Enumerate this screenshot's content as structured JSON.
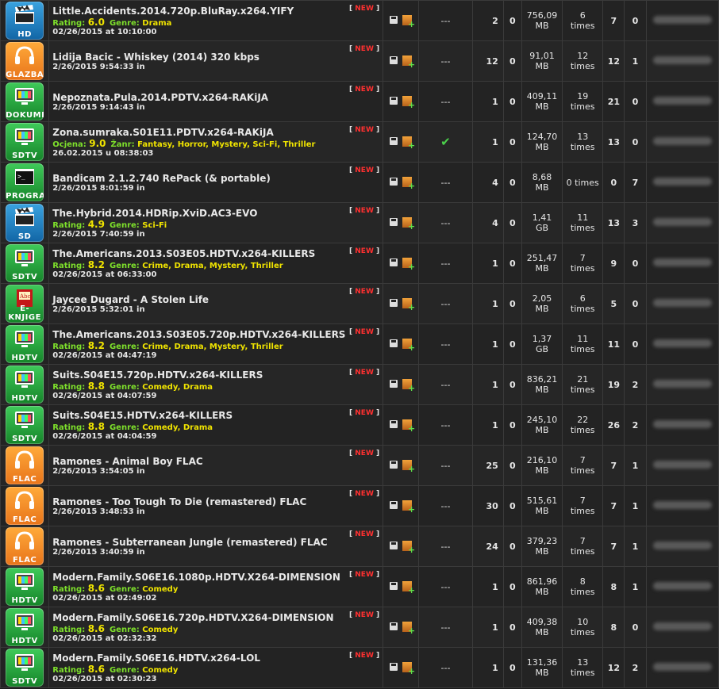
{
  "rows": [
    {
      "cat": "HD",
      "icon": "clapper",
      "cls": "ic-hd",
      "name": "Little.Accidents.2014.720p.BluRay.x264.YIFY",
      "rating_label": "Rating:",
      "rating": "6.0",
      "genre_label": "Genre:",
      "genre": "Drama",
      "date": "02/26/2015 at 10:10:00",
      "new": "NEW",
      "checked": false,
      "files": "2",
      "comments": "0",
      "size1": "756,09",
      "size2": "MB",
      "snatch1": "6",
      "snatch2": "times",
      "seed": "7",
      "leech": "0"
    },
    {
      "cat": "GLAZBA",
      "icon": "headphones",
      "cls": "ic-music",
      "name": "Lidija Bacic - Whiskey (2014) 320 kbps",
      "rating_label": "",
      "rating": "",
      "genre_label": "",
      "genre": "",
      "date": "2/26/2015 9:54:33 in",
      "new": "NEW",
      "checked": false,
      "files": "12",
      "comments": "0",
      "size1": "91,01",
      "size2": "MB",
      "snatch1": "12",
      "snatch2": "times",
      "seed": "12",
      "leech": "1"
    },
    {
      "cat": "DOKUME",
      "icon": "tv",
      "cls": "ic-doc",
      "name": "Nepoznata.Pula.2014.PDTV.x264-RAKiJA",
      "rating_label": "",
      "rating": "",
      "genre_label": "",
      "genre": "",
      "date": "2/26/2015 9:14:43 in",
      "new": "NEW",
      "checked": false,
      "files": "1",
      "comments": "0",
      "size1": "409,11",
      "size2": "MB",
      "snatch1": "19",
      "snatch2": "times",
      "seed": "21",
      "leech": "0"
    },
    {
      "cat": "SDTV",
      "icon": "tv",
      "cls": "ic-doc",
      "name": "Zona.sumraka.S01E11.PDTV.x264-RAKiJA",
      "rating_label": "Ocjena:",
      "rating": "9.0",
      "genre_label": "Žanr:",
      "genre": "Fantasy, Horror, Mystery, Sci-Fi, Thriller",
      "date": "26.02.2015 u 08:38:03",
      "new": "NEW",
      "checked": true,
      "files": "1",
      "comments": "0",
      "size1": "124,70",
      "size2": "MB",
      "snatch1": "13",
      "snatch2": "times",
      "seed": "13",
      "leech": "0"
    },
    {
      "cat": "PROGRAMI",
      "icon": "terminal",
      "cls": "ic-prog",
      "name": "Bandicam 2.1.2.740 RePack (& portable)",
      "rating_label": "",
      "rating": "",
      "genre_label": "",
      "genre": "",
      "date": "2/26/2015 8:01:59 in",
      "new": "NEW",
      "checked": false,
      "files": "4",
      "comments": "0",
      "size1": "8,68",
      "size2": "MB",
      "snatch1": "0 times",
      "snatch2": "",
      "seed": "0",
      "leech": "7"
    },
    {
      "cat": "SD",
      "icon": "clapper",
      "cls": "ic-hd",
      "name": "The.Hybrid.2014.HDRip.XviD.AC3-EVO",
      "rating_label": "Rating:",
      "rating": "4.9",
      "genre_label": "Genre:",
      "genre": "Sci-Fi",
      "date": "2/26/2015 7:40:59 in",
      "new": "NEW",
      "checked": false,
      "files": "4",
      "comments": "0",
      "size1": "1,41",
      "size2": "GB",
      "snatch1": "11",
      "snatch2": "times",
      "seed": "13",
      "leech": "3"
    },
    {
      "cat": "SDTV",
      "icon": "tv",
      "cls": "ic-doc",
      "name": "The.Americans.2013.S03E05.HDTV.x264-KILLERS",
      "rating_label": "Rating:",
      "rating": "8.2",
      "genre_label": "Genre:",
      "genre": "Crime, Drama, Mystery, Thriller",
      "date": "02/26/2015 at 06:33:00",
      "new": "NEW",
      "checked": false,
      "files": "1",
      "comments": "0",
      "size1": "251,47",
      "size2": "MB",
      "snatch1": "7",
      "snatch2": "times",
      "seed": "9",
      "leech": "0"
    },
    {
      "cat": "E-KNJIGE",
      "icon": "book",
      "cls": "ic-ebook",
      "name": "Jaycee Dugard - A Stolen Life",
      "rating_label": "",
      "rating": "",
      "genre_label": "",
      "genre": "",
      "date": "2/26/2015 5:32:01 in",
      "new": "NEW",
      "checked": false,
      "files": "1",
      "comments": "0",
      "size1": "2,05",
      "size2": "MB",
      "snatch1": "6",
      "snatch2": "times",
      "seed": "5",
      "leech": "0"
    },
    {
      "cat": "HDTV",
      "icon": "tv",
      "cls": "ic-doc",
      "name": "The.Americans.2013.S03E05.720p.HDTV.x264-KILLERS",
      "rating_label": "Rating:",
      "rating": "8.2",
      "genre_label": "Genre:",
      "genre": "Crime, Drama, Mystery, Thriller",
      "date": "02/26/2015 at 04:47:19",
      "new": "NEW",
      "checked": false,
      "files": "1",
      "comments": "0",
      "size1": "1,37",
      "size2": "GB",
      "snatch1": "11",
      "snatch2": "times",
      "seed": "11",
      "leech": "0"
    },
    {
      "cat": "HDTV",
      "icon": "tv",
      "cls": "ic-doc",
      "name": "Suits.S04E15.720p.HDTV.x264-KILLERS",
      "rating_label": "Rating:",
      "rating": "8.8",
      "genre_label": "Genre:",
      "genre": "Comedy, Drama",
      "date": "02/26/2015 at 04:07:59",
      "new": "NEW",
      "checked": false,
      "files": "1",
      "comments": "0",
      "size1": "836,21",
      "size2": "MB",
      "snatch1": "21",
      "snatch2": "times",
      "seed": "19",
      "leech": "2"
    },
    {
      "cat": "SDTV",
      "icon": "tv",
      "cls": "ic-doc",
      "name": "Suits.S04E15.HDTV.x264-KILLERS",
      "rating_label": "Rating:",
      "rating": "8.8",
      "genre_label": "Genre:",
      "genre": "Comedy, Drama",
      "date": "02/26/2015 at 04:04:59",
      "new": "NEW",
      "checked": false,
      "files": "1",
      "comments": "0",
      "size1": "245,10",
      "size2": "MB",
      "snatch1": "22",
      "snatch2": "times",
      "seed": "26",
      "leech": "2"
    },
    {
      "cat": "FLAC",
      "icon": "headphones",
      "cls": "ic-music",
      "name": "Ramones - Animal Boy FLAC",
      "rating_label": "",
      "rating": "",
      "genre_label": "",
      "genre": "",
      "date": "2/26/2015 3:54:05 in",
      "new": "NEW",
      "checked": false,
      "files": "25",
      "comments": "0",
      "size1": "216,10",
      "size2": "MB",
      "snatch1": "7",
      "snatch2": "times",
      "seed": "7",
      "leech": "1"
    },
    {
      "cat": "FLAC",
      "icon": "headphones",
      "cls": "ic-music",
      "name": "Ramones - Too Tough To Die (remastered) FLAC",
      "rating_label": "",
      "rating": "",
      "genre_label": "",
      "genre": "",
      "date": "2/26/2015 3:48:53 in",
      "new": "NEW",
      "checked": false,
      "files": "30",
      "comments": "0",
      "size1": "515,61",
      "size2": "MB",
      "snatch1": "7",
      "snatch2": "times",
      "seed": "7",
      "leech": "1"
    },
    {
      "cat": "FLAC",
      "icon": "headphones",
      "cls": "ic-music",
      "name": "Ramones - Subterranean Jungle (remastered) FLAC",
      "rating_label": "",
      "rating": "",
      "genre_label": "",
      "genre": "",
      "date": "2/26/2015 3:40:59 in",
      "new": "NEW",
      "checked": false,
      "files": "24",
      "comments": "0",
      "size1": "379,23",
      "size2": "MB",
      "snatch1": "7",
      "snatch2": "times",
      "seed": "7",
      "leech": "1"
    },
    {
      "cat": "HDTV",
      "icon": "tv",
      "cls": "ic-doc",
      "name": "Modern.Family.S06E16.1080p.HDTV.X264-DIMENSION",
      "rating_label": "Rating:",
      "rating": "8.6",
      "genre_label": "Genre:",
      "genre": "Comedy",
      "date": "02/26/2015 at 02:49:02",
      "new": "NEW",
      "checked": false,
      "files": "1",
      "comments": "0",
      "size1": "861,96",
      "size2": "MB",
      "snatch1": "8",
      "snatch2": "times",
      "seed": "8",
      "leech": "1"
    },
    {
      "cat": "HDTV",
      "icon": "tv",
      "cls": "ic-doc",
      "name": "Modern.Family.S06E16.720p.HDTV.X264-DIMENSION",
      "rating_label": "Rating:",
      "rating": "8.6",
      "genre_label": "Genre:",
      "genre": "Comedy",
      "date": "02/26/2015 at 02:32:32",
      "new": "NEW",
      "checked": false,
      "files": "1",
      "comments": "0",
      "size1": "409,38",
      "size2": "MB",
      "snatch1": "10",
      "snatch2": "times",
      "seed": "8",
      "leech": "0"
    },
    {
      "cat": "SDTV",
      "icon": "tv",
      "cls": "ic-doc",
      "name": "Modern.Family.S06E16.HDTV.x264-LOL",
      "rating_label": "Rating:",
      "rating": "8.6",
      "genre_label": "Genre:",
      "genre": "Comedy",
      "date": "02/26/2015 at 02:30:23",
      "new": "NEW",
      "checked": false,
      "files": "1",
      "comments": "0",
      "size1": "131,36",
      "size2": "MB",
      "snatch1": "13",
      "snatch2": "times",
      "seed": "12",
      "leech": "2"
    }
  ],
  "no_check": "---",
  "check_mark": "✔",
  "colors": {
    "seed": "#7ee02b",
    "leech": "#ff2b2b",
    "rating": "#f0e400",
    "new": "#ff3030"
  }
}
